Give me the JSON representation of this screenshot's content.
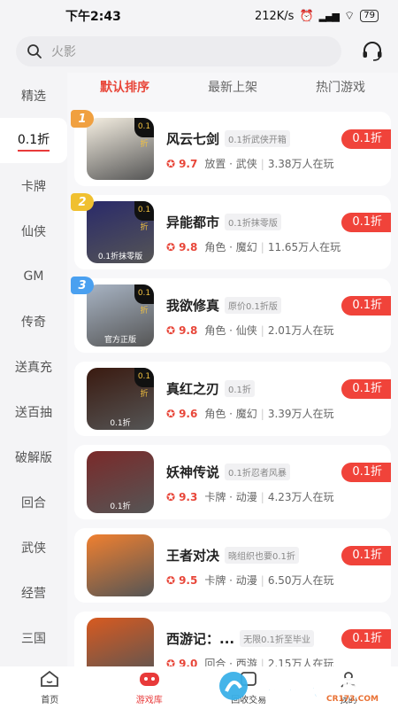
{
  "status": {
    "time": "下午2:43",
    "speed": "212K/s",
    "battery": "79"
  },
  "search": {
    "placeholder": "火影"
  },
  "sidebar": {
    "items": [
      {
        "label": "精选"
      },
      {
        "label": "0.1折",
        "active": true
      },
      {
        "label": "卡牌"
      },
      {
        "label": "仙侠"
      },
      {
        "label": "GM"
      },
      {
        "label": "传奇"
      },
      {
        "label": "送真充"
      },
      {
        "label": "送百抽"
      },
      {
        "label": "破解版"
      },
      {
        "label": "回合"
      },
      {
        "label": "武侠"
      },
      {
        "label": "经营"
      },
      {
        "label": "三国"
      }
    ]
  },
  "tabs": [
    {
      "label": "默认排序",
      "active": true
    },
    {
      "label": "最新上架"
    },
    {
      "label": "热门游戏"
    }
  ],
  "games": [
    {
      "rank": "1",
      "name": "风云七剑",
      "tag": "0.1折武侠开箱",
      "rating": "9.7",
      "genre": "放置 · 武侠",
      "players": "3.38万人在玩",
      "discount": "0.1折",
      "icon_text": "",
      "corner": "0.1折",
      "icon_color": "#f5efe2",
      "rank_color": "#f0a040"
    },
    {
      "rank": "2",
      "name": "异能都市",
      "tag": "0.1折抹零版",
      "rating": "9.8",
      "genre": "角色 · 魔幻",
      "players": "11.65万人在玩",
      "discount": "0.1折",
      "icon_text": "0.1折抹零版",
      "corner": "0.1折",
      "icon_color": "#2a2a6a",
      "rank_color": "#f0c030"
    },
    {
      "rank": "3",
      "name": "我欲修真",
      "tag": "原价0.1折版",
      "rating": "9.8",
      "genre": "角色 · 仙侠",
      "players": "2.01万人在玩",
      "discount": "0.1折",
      "icon_text": "官方正版",
      "corner": "0.1折",
      "icon_color": "#a8b4c4",
      "rank_color": "#4aa0f0"
    },
    {
      "name": "真红之刃",
      "tag": "0.1折",
      "rating": "9.6",
      "genre": "角色 · 魔幻",
      "players": "3.39万人在玩",
      "discount": "0.1折",
      "icon_text": "0.1折",
      "corner": "0.1折",
      "icon_color": "#3a1a10"
    },
    {
      "name": "妖神传说",
      "tag": "0.1折忍者风暴",
      "rating": "9.3",
      "genre": "卡牌 · 动漫",
      "players": "4.23万人在玩",
      "discount": "0.1折",
      "icon_text": "0.1折",
      "corner": "",
      "icon_color": "#7a2a2a"
    },
    {
      "name": "王者对决",
      "tag": "晓组织也要0.1折",
      "rating": "9.5",
      "genre": "卡牌 · 动漫",
      "players": "6.50万人在玩",
      "discount": "0.1折",
      "icon_text": "",
      "corner": "",
      "icon_color": "#f08030"
    },
    {
      "name": "西游记：...",
      "tag": "无限0.1折至毕业",
      "rating": "9.0",
      "genre": "回合 · 西游",
      "players": "2.15万人在玩",
      "discount": "0.1折",
      "icon_text": "",
      "corner": "",
      "icon_color": "#d85a20"
    }
  ],
  "bottom_nav": [
    {
      "label": "首页",
      "icon": "home-icon"
    },
    {
      "label": "游戏库",
      "icon": "game-library-icon",
      "active": true
    },
    {
      "label": "回收交易",
      "icon": "trade-icon"
    },
    {
      "label": "我的",
      "icon": "profile-icon"
    }
  ],
  "watermark": {
    "text": "西西软件园",
    "sub": "CR173.COM"
  },
  "colors": {
    "accent": "#f0433a",
    "active_text": "#e8473a"
  }
}
